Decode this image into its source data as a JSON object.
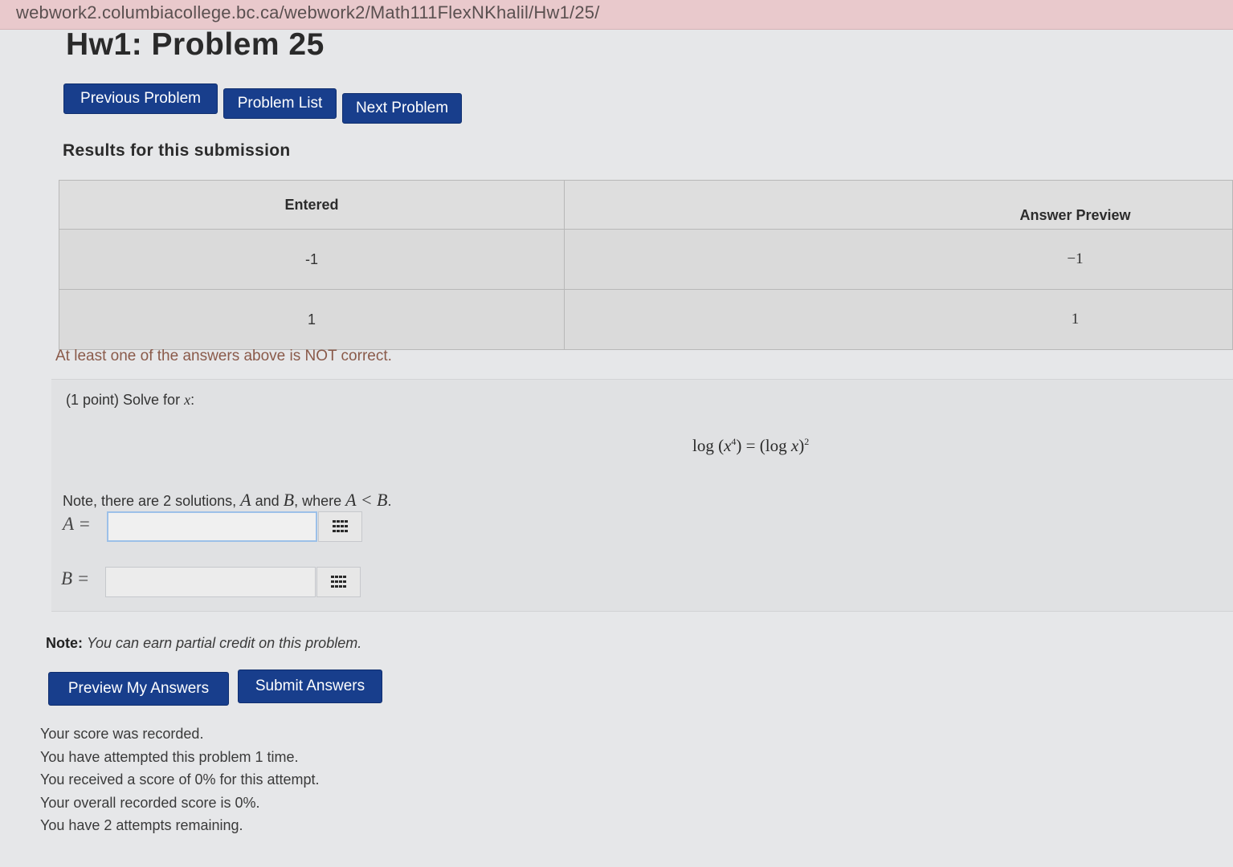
{
  "browser": {
    "url": "webwork2.columbiacollege.bc.ca/webwork2/Math111FlexNKhalil/Hw1/25/"
  },
  "page": {
    "title": "Hw1: Problem 25"
  },
  "nav": {
    "previous_label": "Previous Problem",
    "list_label": "Problem List",
    "next_label": "Next Problem"
  },
  "results": {
    "heading": "Results for this submission",
    "columns": [
      "Entered",
      "Answer Preview"
    ],
    "rows": [
      {
        "entered": "-1",
        "preview": "−1"
      },
      {
        "entered": "1",
        "preview": "1"
      }
    ],
    "feedback": "At least one of the answers above is NOT correct."
  },
  "problem": {
    "intro": "(1 point) Solve for",
    "intro_var": "x",
    "intro_suffix": ":",
    "equation": {
      "lhs_func": "log",
      "lhs_arg": "x",
      "lhs_exp": "4",
      "rhs_func": "log",
      "rhs_arg": "x",
      "rhs_exp": "2"
    },
    "note_prefix": "Note, there are 2 solutions,",
    "var_a": "A",
    "and_text": "and",
    "var_b": "B",
    "where_text": ", where",
    "relation": "A < B",
    "label_a": "A =",
    "label_b": "B =",
    "input_a_value": "",
    "input_b_value": "",
    "palette_icon": "grid-icon"
  },
  "partial_credit": {
    "label": "Note:",
    "text": "You can earn partial credit on this problem."
  },
  "actions": {
    "preview_label": "Preview My Answers",
    "submit_label": "Submit Answers"
  },
  "score": {
    "lines": [
      "Your score was recorded.",
      "You have attempted this problem 1 time.",
      "You received a score of 0% for this attempt.",
      "Your overall recorded score is 0%.",
      "You have 2 attempts remaining."
    ]
  },
  "colors": {
    "button_bg": "#183e8c",
    "url_bar": "#e9c9cc",
    "feedback_text": "#8a5a4a"
  }
}
